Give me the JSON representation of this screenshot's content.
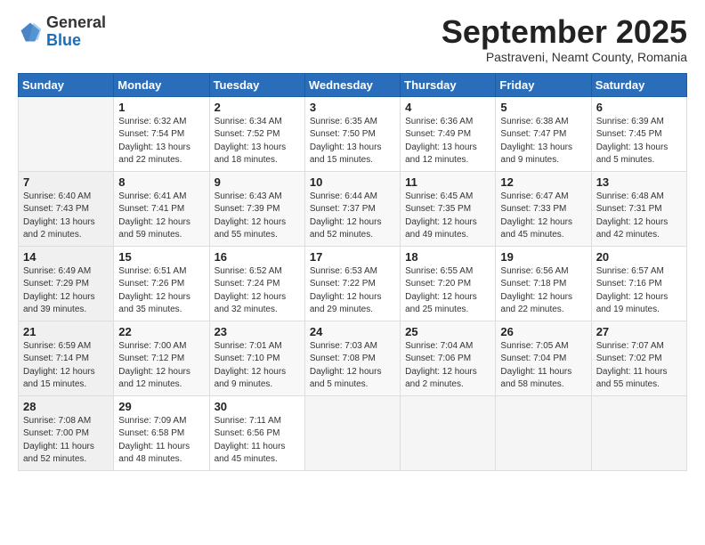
{
  "header": {
    "logo": {
      "general": "General",
      "blue": "Blue"
    },
    "month": "September 2025",
    "location": "Pastraveni, Neamt County, Romania"
  },
  "weekdays": [
    "Sunday",
    "Monday",
    "Tuesday",
    "Wednesday",
    "Thursday",
    "Friday",
    "Saturday"
  ],
  "weeks": [
    [
      {
        "day": "",
        "info": ""
      },
      {
        "day": "1",
        "info": "Sunrise: 6:32 AM\nSunset: 7:54 PM\nDaylight: 13 hours\nand 22 minutes."
      },
      {
        "day": "2",
        "info": "Sunrise: 6:34 AM\nSunset: 7:52 PM\nDaylight: 13 hours\nand 18 minutes."
      },
      {
        "day": "3",
        "info": "Sunrise: 6:35 AM\nSunset: 7:50 PM\nDaylight: 13 hours\nand 15 minutes."
      },
      {
        "day": "4",
        "info": "Sunrise: 6:36 AM\nSunset: 7:49 PM\nDaylight: 13 hours\nand 12 minutes."
      },
      {
        "day": "5",
        "info": "Sunrise: 6:38 AM\nSunset: 7:47 PM\nDaylight: 13 hours\nand 9 minutes."
      },
      {
        "day": "6",
        "info": "Sunrise: 6:39 AM\nSunset: 7:45 PM\nDaylight: 13 hours\nand 5 minutes."
      }
    ],
    [
      {
        "day": "7",
        "info": "Sunrise: 6:40 AM\nSunset: 7:43 PM\nDaylight: 13 hours\nand 2 minutes."
      },
      {
        "day": "8",
        "info": "Sunrise: 6:41 AM\nSunset: 7:41 PM\nDaylight: 12 hours\nand 59 minutes."
      },
      {
        "day": "9",
        "info": "Sunrise: 6:43 AM\nSunset: 7:39 PM\nDaylight: 12 hours\nand 55 minutes."
      },
      {
        "day": "10",
        "info": "Sunrise: 6:44 AM\nSunset: 7:37 PM\nDaylight: 12 hours\nand 52 minutes."
      },
      {
        "day": "11",
        "info": "Sunrise: 6:45 AM\nSunset: 7:35 PM\nDaylight: 12 hours\nand 49 minutes."
      },
      {
        "day": "12",
        "info": "Sunrise: 6:47 AM\nSunset: 7:33 PM\nDaylight: 12 hours\nand 45 minutes."
      },
      {
        "day": "13",
        "info": "Sunrise: 6:48 AM\nSunset: 7:31 PM\nDaylight: 12 hours\nand 42 minutes."
      }
    ],
    [
      {
        "day": "14",
        "info": "Sunrise: 6:49 AM\nSunset: 7:29 PM\nDaylight: 12 hours\nand 39 minutes."
      },
      {
        "day": "15",
        "info": "Sunrise: 6:51 AM\nSunset: 7:26 PM\nDaylight: 12 hours\nand 35 minutes."
      },
      {
        "day": "16",
        "info": "Sunrise: 6:52 AM\nSunset: 7:24 PM\nDaylight: 12 hours\nand 32 minutes."
      },
      {
        "day": "17",
        "info": "Sunrise: 6:53 AM\nSunset: 7:22 PM\nDaylight: 12 hours\nand 29 minutes."
      },
      {
        "day": "18",
        "info": "Sunrise: 6:55 AM\nSunset: 7:20 PM\nDaylight: 12 hours\nand 25 minutes."
      },
      {
        "day": "19",
        "info": "Sunrise: 6:56 AM\nSunset: 7:18 PM\nDaylight: 12 hours\nand 22 minutes."
      },
      {
        "day": "20",
        "info": "Sunrise: 6:57 AM\nSunset: 7:16 PM\nDaylight: 12 hours\nand 19 minutes."
      }
    ],
    [
      {
        "day": "21",
        "info": "Sunrise: 6:59 AM\nSunset: 7:14 PM\nDaylight: 12 hours\nand 15 minutes."
      },
      {
        "day": "22",
        "info": "Sunrise: 7:00 AM\nSunset: 7:12 PM\nDaylight: 12 hours\nand 12 minutes."
      },
      {
        "day": "23",
        "info": "Sunrise: 7:01 AM\nSunset: 7:10 PM\nDaylight: 12 hours\nand 9 minutes."
      },
      {
        "day": "24",
        "info": "Sunrise: 7:03 AM\nSunset: 7:08 PM\nDaylight: 12 hours\nand 5 minutes."
      },
      {
        "day": "25",
        "info": "Sunrise: 7:04 AM\nSunset: 7:06 PM\nDaylight: 12 hours\nand 2 minutes."
      },
      {
        "day": "26",
        "info": "Sunrise: 7:05 AM\nSunset: 7:04 PM\nDaylight: 11 hours\nand 58 minutes."
      },
      {
        "day": "27",
        "info": "Sunrise: 7:07 AM\nSunset: 7:02 PM\nDaylight: 11 hours\nand 55 minutes."
      }
    ],
    [
      {
        "day": "28",
        "info": "Sunrise: 7:08 AM\nSunset: 7:00 PM\nDaylight: 11 hours\nand 52 minutes."
      },
      {
        "day": "29",
        "info": "Sunrise: 7:09 AM\nSunset: 6:58 PM\nDaylight: 11 hours\nand 48 minutes."
      },
      {
        "day": "30",
        "info": "Sunrise: 7:11 AM\nSunset: 6:56 PM\nDaylight: 11 hours\nand 45 minutes."
      },
      {
        "day": "",
        "info": ""
      },
      {
        "day": "",
        "info": ""
      },
      {
        "day": "",
        "info": ""
      },
      {
        "day": "",
        "info": ""
      }
    ]
  ]
}
